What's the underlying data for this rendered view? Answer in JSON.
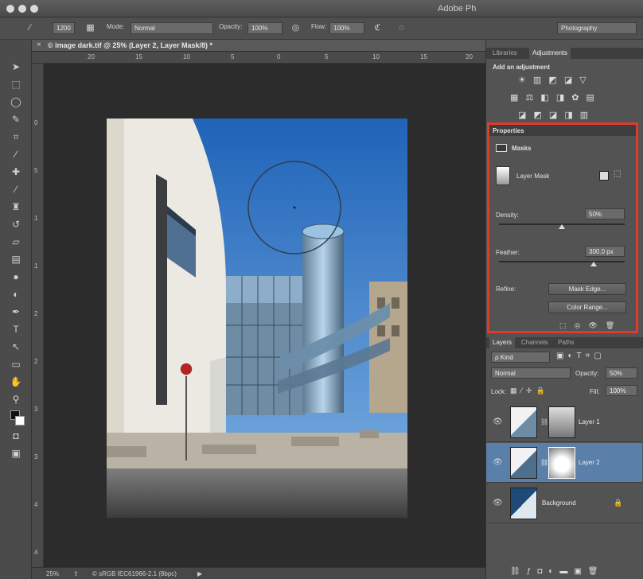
{
  "app": {
    "title": "Adobe Ph"
  },
  "options_bar": {
    "brush_size": "1200",
    "mode_label": "Mode:",
    "mode_value": "Normal",
    "opacity_label": "Opacity:",
    "opacity_value": "100%",
    "flow_label": "Flow:",
    "flow_value": "100%",
    "workspace": "Photography"
  },
  "document": {
    "tab_title": "© image dark.tif @ 25% (Layer 2, Layer Mask/8) *",
    "ruler_h": [
      "20",
      "15",
      "10",
      "5",
      "0",
      "5",
      "10",
      "15",
      "20"
    ],
    "ruler_v": [
      "0",
      "5",
      "1",
      "1",
      "2",
      "2",
      "3",
      "3",
      "4",
      "4"
    ],
    "zoom": "25%",
    "color_profile": "© sRGB IEC61966-2.1 (8bpc)"
  },
  "adjustments_panel": {
    "tabs": [
      "Libraries",
      "Adjustments"
    ],
    "heading": "Add an adjustment",
    "icon_rows": [
      "☀ ▥ ◩ ◪ ▽",
      "▦ ⚖ ◧ ◨ ✿ ▤",
      "◪ ◩ ◪ ◨ ▥"
    ]
  },
  "properties_panel": {
    "title": "Properties",
    "section": "Masks",
    "mask_type": "Layer Mask",
    "density_label": "Density:",
    "density_value": "50%",
    "density_fraction": 0.5,
    "feather_label": "Feather:",
    "feather_value": "300.0 px",
    "feather_fraction": 0.75,
    "refine_label": "Refine:",
    "mask_edge_button": "Mask Edge...",
    "color_range_button": "Color Range..."
  },
  "layers_panel": {
    "tabs": [
      "Layers",
      "Channels",
      "Paths"
    ],
    "filter": "ρ Kind",
    "blend_mode": "Normal",
    "opacity_label": "Opacity:",
    "opacity_value": "50%",
    "lock_label": "Lock:",
    "fill_label": "Fill:",
    "fill_value": "100%",
    "layers": [
      {
        "name": "Layer 1"
      },
      {
        "name": "Layer 2"
      },
      {
        "name": "Background"
      }
    ]
  },
  "colors": {
    "highlight": "#e03a2a",
    "selected_layer": "#5a7fa8"
  }
}
